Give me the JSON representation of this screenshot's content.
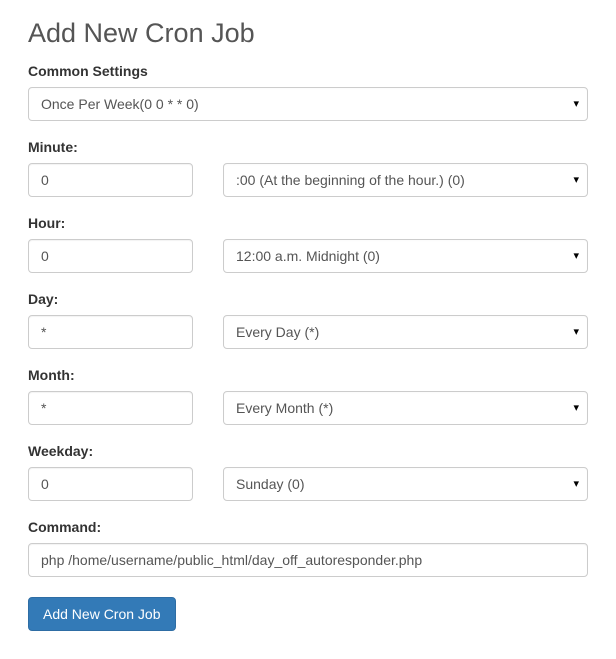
{
  "title": "Add New Cron Job",
  "common_settings": {
    "label": "Common Settings",
    "value": "Once Per Week(0 0 * * 0)"
  },
  "fields": {
    "minute": {
      "label": "Minute:",
      "input_value": "0",
      "select_value": ":00 (At the beginning of the hour.) (0)"
    },
    "hour": {
      "label": "Hour:",
      "input_value": "0",
      "select_value": "12:00 a.m. Midnight (0)"
    },
    "day": {
      "label": "Day:",
      "input_value": "*",
      "select_value": "Every Day (*)"
    },
    "month": {
      "label": "Month:",
      "input_value": "*",
      "select_value": "Every Month (*)"
    },
    "weekday": {
      "label": "Weekday:",
      "input_value": "0",
      "select_value": "Sunday (0)"
    }
  },
  "command": {
    "label": "Command:",
    "value": "php /home/username/public_html/day_off_autoresponder.php"
  },
  "submit_label": "Add New Cron Job"
}
